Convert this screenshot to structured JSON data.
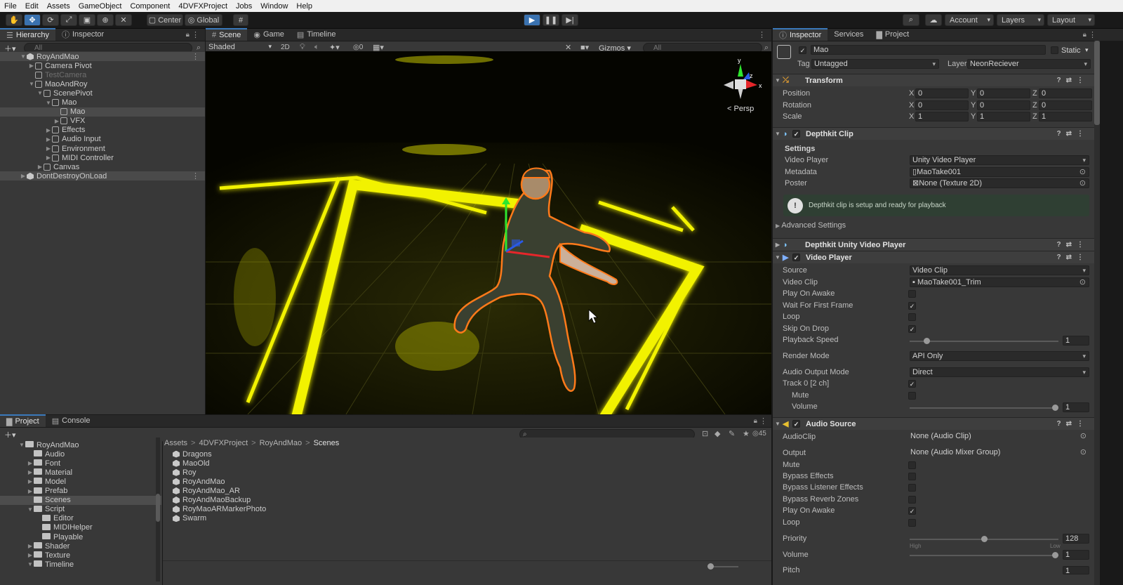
{
  "menu": [
    "File",
    "Edit",
    "Assets",
    "GameObject",
    "Component",
    "4DVFXProject",
    "Jobs",
    "Window",
    "Help"
  ],
  "toolbar": {
    "center": "Center",
    "global": "Global",
    "account": "Account",
    "layers": "Layers",
    "layout": "Layout"
  },
  "hierarchy": {
    "tabs": {
      "hierarchy": "Hierarchy",
      "inspector": "Inspector"
    },
    "search": "All",
    "rows": [
      {
        "label": "RoyAndMao",
        "depth": 0,
        "icon": "scene",
        "arrow": "▼",
        "sel": true,
        "muted": false
      },
      {
        "label": "Camera Pivot",
        "depth": 1,
        "icon": "cube",
        "arrow": "▶",
        "sel": false,
        "muted": false
      },
      {
        "label": "TestCamera",
        "depth": 1,
        "icon": "cube",
        "arrow": "",
        "sel": false,
        "muted": true
      },
      {
        "label": "MaoAndRoy",
        "depth": 1,
        "icon": "cube",
        "arrow": "▼",
        "sel": false,
        "muted": false
      },
      {
        "label": "ScenePivot",
        "depth": 2,
        "icon": "cube",
        "arrow": "▼",
        "sel": false,
        "muted": false
      },
      {
        "label": "Mao",
        "depth": 3,
        "icon": "cube",
        "arrow": "▼",
        "sel": false,
        "muted": false
      },
      {
        "label": "Mao",
        "depth": 4,
        "icon": "cube",
        "arrow": "",
        "sel": true,
        "muted": false
      },
      {
        "label": "VFX",
        "depth": 4,
        "icon": "cube",
        "arrow": "▶",
        "sel": false,
        "muted": false
      },
      {
        "label": "Effects",
        "depth": 3,
        "icon": "cube",
        "arrow": "▶",
        "sel": false,
        "muted": false
      },
      {
        "label": "Audio Input",
        "depth": 3,
        "icon": "cube",
        "arrow": "▶",
        "sel": false,
        "muted": false
      },
      {
        "label": "Environment",
        "depth": 3,
        "icon": "cube",
        "arrow": "▶",
        "sel": false,
        "muted": false
      },
      {
        "label": "MIDI Controller",
        "depth": 3,
        "icon": "cube",
        "arrow": "▶",
        "sel": false,
        "muted": false
      },
      {
        "label": "Canvas",
        "depth": 2,
        "icon": "cube",
        "arrow": "▶",
        "sel": false,
        "muted": false
      },
      {
        "label": "DontDestroyOnLoad",
        "depth": 0,
        "icon": "scene",
        "arrow": "▶",
        "sel": true,
        "muted": false
      }
    ]
  },
  "scene": {
    "tabs": {
      "scene": "Scene",
      "game": "Game",
      "timeline": "Timeline"
    },
    "shading": "Shaded",
    "mode2d": "2D",
    "hidden_count": "0",
    "gizmos": "Gizmos",
    "search": "All",
    "persp": "Persp",
    "axes": {
      "x": "x",
      "y": "y",
      "z": "z"
    }
  },
  "project": {
    "tabs": {
      "project": "Project",
      "console": "Console"
    },
    "hidden_count": "45",
    "tree": [
      {
        "label": "RoyAndMao",
        "depth": 0,
        "arrow": "▼",
        "sel": false
      },
      {
        "label": "Audio",
        "depth": 1,
        "arrow": "",
        "sel": false
      },
      {
        "label": "Font",
        "depth": 1,
        "arrow": "▶",
        "sel": false
      },
      {
        "label": "Material",
        "depth": 1,
        "arrow": "▶",
        "sel": false
      },
      {
        "label": "Model",
        "depth": 1,
        "arrow": "▶",
        "sel": false
      },
      {
        "label": "Prefab",
        "depth": 1,
        "arrow": "▶",
        "sel": false
      },
      {
        "label": "Scenes",
        "depth": 1,
        "arrow": "",
        "sel": true
      },
      {
        "label": "Script",
        "depth": 1,
        "arrow": "▼",
        "sel": false
      },
      {
        "label": "Editor",
        "depth": 2,
        "arrow": "",
        "sel": false
      },
      {
        "label": "MIDIHelper",
        "depth": 2,
        "arrow": "",
        "sel": false
      },
      {
        "label": "Playable",
        "depth": 2,
        "arrow": "",
        "sel": false
      },
      {
        "label": "Shader",
        "depth": 1,
        "arrow": "▶",
        "sel": false
      },
      {
        "label": "Texture",
        "depth": 1,
        "arrow": "▶",
        "sel": false
      },
      {
        "label": "Timeline",
        "depth": 1,
        "arrow": "▼",
        "sel": false
      }
    ],
    "breadcrumb": [
      "Assets",
      "4DVFXProject",
      "RoyAndMao",
      "Scenes"
    ],
    "files": [
      "Dragons",
      "MaoOld",
      "Roy",
      "RoyAndMao",
      "RoyAndMao_AR",
      "RoyAndMaoBackup",
      "RoyMaoARMarkerPhoto",
      "Swarm"
    ]
  },
  "inspector": {
    "tabs": {
      "inspector": "Inspector",
      "services": "Services",
      "project": "Project"
    },
    "object_name": "Mao",
    "static": "Static",
    "tag_label": "Tag",
    "tag": "Untagged",
    "layer_label": "Layer",
    "layer": "NeonReciever",
    "transform": {
      "title": "Transform",
      "position": "Position",
      "rotation": "Rotation",
      "scale": "Scale",
      "pos": [
        "0",
        "0",
        "0"
      ],
      "rot": [
        "0",
        "0",
        "0"
      ],
      "scl": [
        "1",
        "1",
        "1"
      ],
      "x": "X",
      "y": "Y",
      "z": "Z"
    },
    "depthkit": {
      "title": "Depthkit Clip",
      "settings": "Settings",
      "video_player_label": "Video Player",
      "video_player": "Unity Video Player",
      "metadata_label": "Metadata",
      "metadata": "MaoTake001",
      "poster_label": "Poster",
      "poster": "None (Texture 2D)",
      "info": "Depthkit clip is setup and ready for playback",
      "advanced": "Advanced Settings"
    },
    "dk_video": {
      "title": "Depthkit Unity Video Player"
    },
    "video": {
      "title": "Video Player",
      "source_label": "Source",
      "source": "Video Clip",
      "clip_label": "Video Clip",
      "clip": "MaoTake001_Trim",
      "play_on_awake": "Play On Awake",
      "wait_first": "Wait For First Frame",
      "loop": "Loop",
      "skip_drop": "Skip On Drop",
      "speed_label": "Playback Speed",
      "speed": "1",
      "speed_level": 0.1,
      "render_label": "Render Mode",
      "render": "API Only",
      "audio_mode_label": "Audio Output Mode",
      "audio_mode": "Direct",
      "track": "Track 0 [2 ch]",
      "mute": "Mute",
      "volume_label": "Volume",
      "volume": "1",
      "volume_level": 1.0
    },
    "audio": {
      "title": "Audio Source",
      "clip_label": "AudioClip",
      "clip": "None (Audio Clip)",
      "output_label": "Output",
      "output": "None (Audio Mixer Group)",
      "mute": "Mute",
      "bypass_fx": "Bypass Effects",
      "bypass_listener": "Bypass Listener Effects",
      "bypass_reverb": "Bypass Reverb Zones",
      "play_on_awake": "Play On Awake",
      "loop": "Loop",
      "priority_label": "Priority",
      "priority": "128",
      "priority_level": 0.5,
      "high": "High",
      "low": "Low",
      "volume_label": "Volume",
      "volume": "1",
      "volume_level": 1.0,
      "pitch_label": "Pitch",
      "pitch": "1"
    }
  },
  "colors": {
    "accent": "#3a79bb",
    "neon": "#f2f200",
    "outline": "#ff7a1a",
    "info_bg": "#2f3f33"
  }
}
